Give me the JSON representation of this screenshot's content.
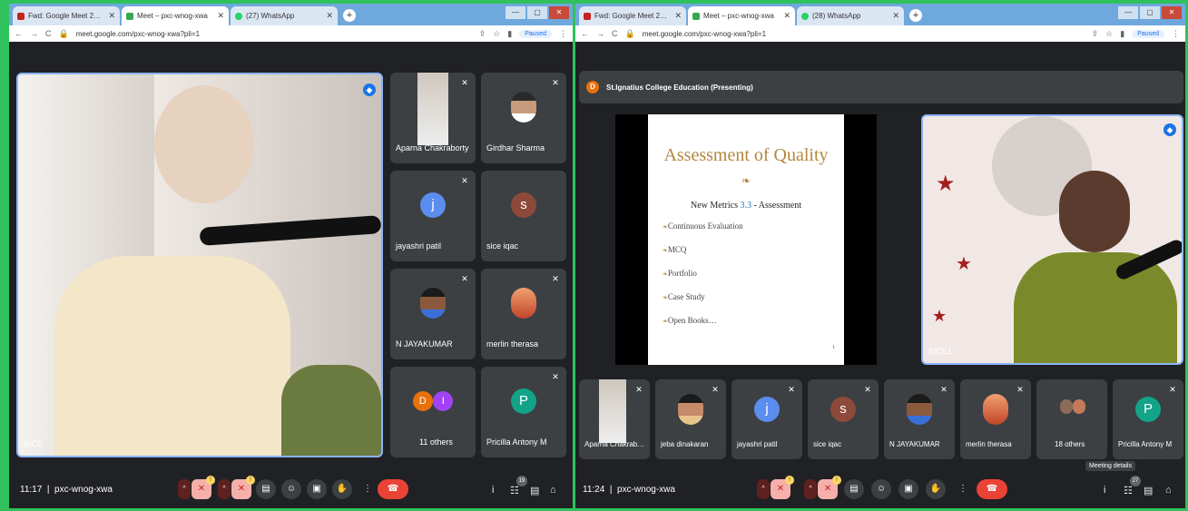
{
  "left": {
    "tabs": [
      {
        "label": "Fwd: Google Meet 2nd link - my",
        "color": "#c5221f"
      },
      {
        "label": "Meet – pxc-wnog-xwa",
        "color": "#34a853"
      },
      {
        "label": "(27) WhatsApp",
        "color": "#25d366"
      }
    ],
    "url": "meet.google.com/pxc-wnog-xwa?pli=1",
    "paused": "Paused",
    "main_name": "SICE",
    "tiles": [
      {
        "name": "Aparna Chakraborty"
      },
      {
        "name": "Girdhar Sharma"
      },
      {
        "name": "jayashri patil",
        "initial": "j",
        "color": "#5b8def"
      },
      {
        "name": "sice iqac",
        "initial": "s",
        "color": "#8d4a3a"
      },
      {
        "name": "N JAYAKUMAR"
      },
      {
        "name": "merlin therasa"
      },
      {
        "name": "11 others",
        "initial1": "D",
        "initial2": "I"
      },
      {
        "name": "Pricilla Antony M",
        "initial": "P",
        "color": "#12a389"
      }
    ],
    "time": "11:17",
    "code": "pxc-wnog-xwa",
    "participants_count": "19",
    "mic_badge": "!"
  },
  "right": {
    "tabs": [
      {
        "label": "Fwd: Google Meet 2nd link - my",
        "color": "#c5221f"
      },
      {
        "label": "Meet – pxc-wnog-xwa",
        "color": "#34a853"
      },
      {
        "label": "(28) WhatsApp",
        "color": "#25d366"
      }
    ],
    "url": "meet.google.com/pxc-wnog-xwa?pli=1",
    "paused": "Paused",
    "presenter_initial": "D",
    "presenter": "St.Ignatius College Education (Presenting)",
    "slide": {
      "title": "Assessment of Quality",
      "subtitle_pre": "New Metrics ",
      "subtitle_num": "3.3",
      "subtitle_post": " - Assessment",
      "bullets": [
        "Continuous Evaluation",
        "MCQ",
        "Portfolio",
        "Case Study",
        "Open Books…"
      ],
      "page": "1"
    },
    "side_name": "SICE1",
    "tiles": [
      {
        "name": "Aparna Chakrab…"
      },
      {
        "name": "jeba dinakaran"
      },
      {
        "name": "jayashri patil",
        "initial": "j",
        "color": "#5b8def"
      },
      {
        "name": "sice iqac",
        "initial": "s",
        "color": "#8d4a3a"
      },
      {
        "name": "N JAYAKUMAR"
      },
      {
        "name": "merlin therasa"
      },
      {
        "name": "18 others"
      },
      {
        "name": "Pricilla Antony M",
        "initial": "P",
        "color": "#12a389"
      }
    ],
    "time": "11:24",
    "code": "pxc-wnog-xwa",
    "participants_count": "27",
    "tooltip": "Meeting details",
    "mic_badge": "!"
  },
  "icons": {
    "mic_off": "✕",
    "arrow_up": "^",
    "hang_up": "☎",
    "info": "i",
    "people": "☷",
    "chat": "▤",
    "activities": "⌂",
    "more": "⋮",
    "raise_hand": "✋",
    "present": "▣",
    "emoji": "☺",
    "captions": "▤"
  }
}
